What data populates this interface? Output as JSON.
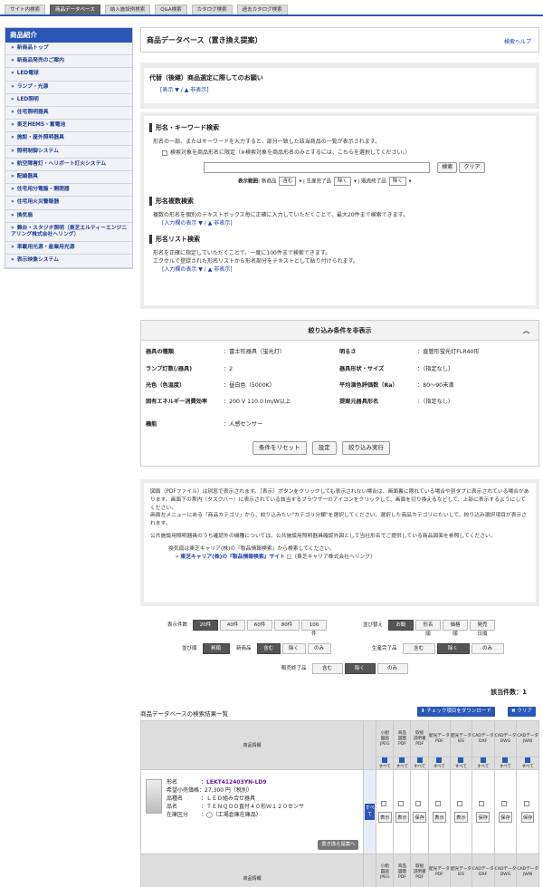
{
  "tabs": [
    "サイト内検索",
    "商品データベース",
    "納入施設例検索",
    "Q&A検索",
    "カタログ検索",
    "過去カタログ検索"
  ],
  "sidebar": {
    "header": "商品紹介",
    "items": [
      "新商品トップ",
      "新商品発売のご案内",
      "LED電球",
      "ランプ・光源",
      "LED照明",
      "住宅照明器具",
      "東芝HEMS・蓄電池",
      "施設・屋外照明器具",
      "照明制御システム",
      "航空障害灯・ヘリポート灯火システム",
      "配線器具",
      "住宅用分電盤・開閉器",
      "住宅用火災警報器",
      "換気扇",
      "舞台・スタジオ照明（東芝エルティーエンジニアリング株式会社ヘリング）",
      "車載用光源・産業用光源",
      "表示映像システム"
    ]
  },
  "page": {
    "title": "商品データベース（置き換え提案）",
    "help": "検索ヘルプ"
  },
  "notice": {
    "title": "代替（後継）商品選定に際してのお願い",
    "link": "[表示 ▼ / ▲ 非表示]"
  },
  "search": {
    "kw_head": "形名・キーワード検索",
    "kw_desc": "形名の一部、またはキーワードを入力すると、部分一致した該当商品の一覧が表示されます。",
    "kw_check": "検索対象を商品形名に限定（※検索対象を商品形名のみとするには、こちらを選択してください。）",
    "btn_search": "検索",
    "btn_clear": "クリア",
    "range_label": "表示範囲:",
    "new_label": "新商品",
    "new_val": "含む",
    "prod_label": "生産完了品",
    "prod_val": "除く",
    "sold_label": "販売終了品",
    "sold_val": "除く",
    "multi_head": "形名複数検索",
    "multi_desc": "複数の形名を個別のテキストボックス毎に正確に入力していただくことで、最大20件まで検索できます。",
    "multi_link": "[入力欄の表示 ▼ / ▲ 非表示]",
    "list_head": "形名リスト検索",
    "list_desc1": "形名を正確に指定していただくことで、一度に100件まで検索できます。",
    "list_desc2": "エクセルで登録された形名リストから形名部分をテキストとして貼り付けられます。",
    "list_link": "[入力欄の表示 ▼ / ▲ 非表示]"
  },
  "filters": {
    "header": "絞り込み条件を非表示",
    "caret": "︿",
    "left": [
      {
        "k": "器具の種類",
        "v": "：富士形器具（蛍光灯）"
      },
      {
        "k": "ランプ灯数(/器具)",
        "v": "：2"
      },
      {
        "k": "光色（色温度）",
        "v": "：昼白色（5000K）"
      },
      {
        "k": "固有エネルギー消費効率",
        "v": "：200 V  110.0 lm/W以上"
      },
      {
        "k": "機能",
        "v": "：人感センサー"
      }
    ],
    "right": [
      {
        "k": "明るさ",
        "v": "：直管形蛍光灯FLR40形"
      },
      {
        "k": "器具形状・サイズ",
        "v": "：（指定なし）"
      },
      {
        "k": "平均演色評価数（Ra）",
        "v": "：80～90未満"
      },
      {
        "k": "提案元器具形名",
        "v": "：（指定なし）"
      }
    ],
    "btn_reset": "条件をリセット",
    "btn_set": "設定",
    "btn_run": "絞り込み実行"
  },
  "info": {
    "p1": "図面（PDFファイル）は別窓で表示されます。［表示］ボタンをクリックしても表示されない場合は、画面裏に隠れている場合や別タブに表示されている場合があります。画面下の帯内（タスクバー）に表示されている該当するブラウザーのアイコンをクリックして、画面を切り換えるなどして、上部に表示するようにしてください。",
    "p2": "画面左メニューにある「商品カテゴリ」から、絞り込みたい\"カテゴリ分類\"を選択してください。選択した商品カテゴリにたいして、絞り込み選択項目が表示されます。",
    "p3": "公共施設用照明器具のうち確認外の機種については、公共施設用照明器具確認外図として当社形名でご提供している商品図面を参照してください。",
    "p4": "換気扇は東芝キャリア(株)の『製品情報検索』から検索してください。",
    "p5_link": "東芝キャリア(株)の『製品情報検索』サイト",
    "p5_tail": "（東芝キャリア株式会社ヘリング）"
  },
  "opts": {
    "per_label": "表示件数",
    "per": [
      "20件",
      "40件",
      "60件",
      "80件",
      "100件"
    ],
    "sort_label": "並び替え",
    "sort": [
      "お勧め順",
      "形名順",
      "価格順",
      "発売日順"
    ],
    "order_label": "並び順",
    "order": [
      "昇順"
    ],
    "new_label": "新商品",
    "new": [
      "含む",
      "除く",
      "のみ"
    ],
    "prod_label": "生産完了品",
    "prod": [
      "含む",
      "除く",
      "のみ"
    ],
    "sold_label": "販売終了品",
    "sold": [
      "含む",
      "除く",
      "のみ"
    ]
  },
  "count": "該当件数：1",
  "list": {
    "title": "商品データベースの検索結果一覧",
    "dl": "チェック項目をダウンロード",
    "clear": "クリア",
    "col_info": "商品情報",
    "cols": [
      "小組\n図画\nJPEG",
      "商品\n図面\nPDF",
      "取扱\n説明書\nPDF",
      "配光データ\nPDF",
      "配光データ\nIES",
      "CADデータ\nDXF",
      "CADデータ\nDWG",
      "CADデータ\nJWW"
    ],
    "grp_light": "配光データ",
    "grp_cad": "器図CADデータ",
    "all": "すべて",
    "show": "表示",
    "save": "保存",
    "product": {
      "model_k": "形名",
      "model_v": "LEKT412403YN-LD9",
      "price_k": "希望小売価格",
      "price_v": "27,300 円（税別）",
      "name_k": "品種名",
      "name_v": "ＬＥＤ組み合せ器具",
      "spec_k": "品名",
      "spec_v": "ＴＥＮＱＯＯ直付４０形Ｗ１２０センサ",
      "stock_k": "在庫区分",
      "stock_v": "◯（工場倉庫在庫品）",
      "repl": "置き換え提案へ"
    }
  }
}
